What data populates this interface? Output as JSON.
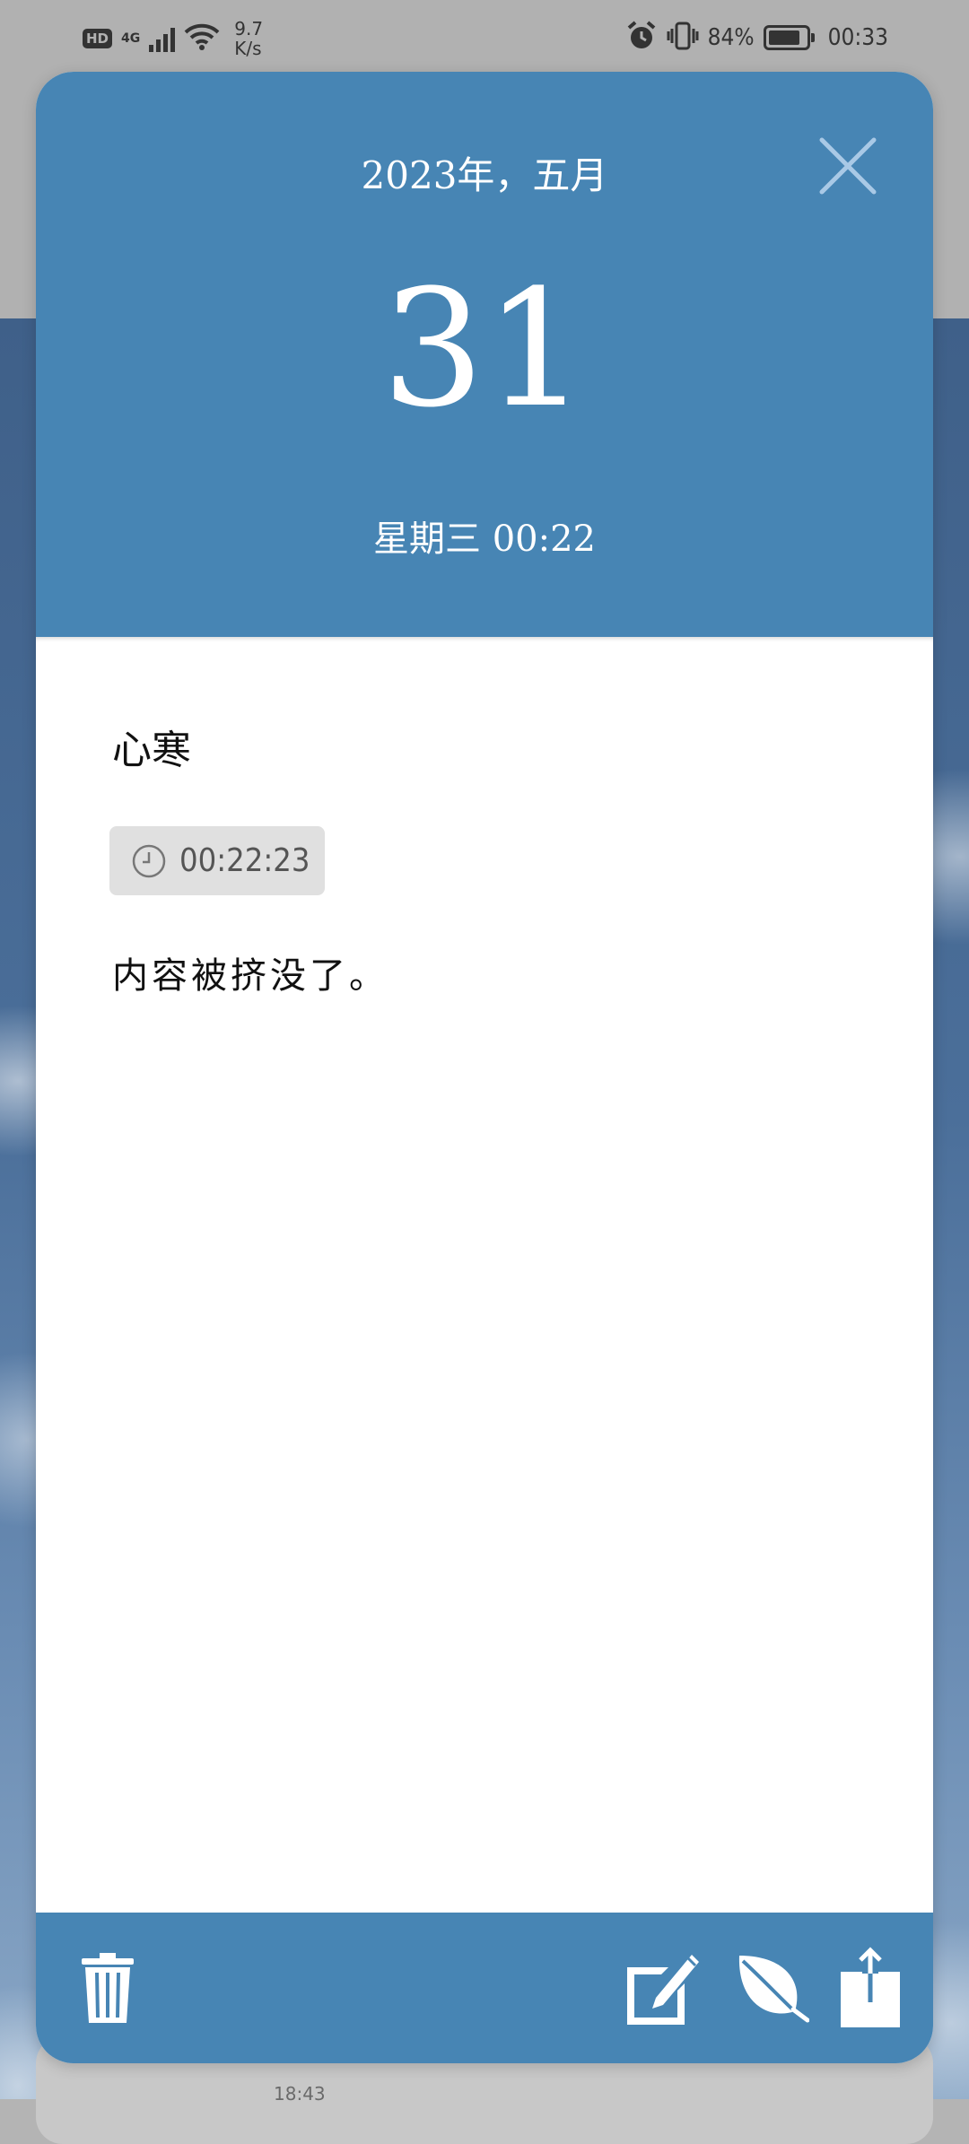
{
  "status_bar": {
    "hd_label": "HD",
    "network_label": "4G",
    "speed_value": "9.7",
    "speed_unit": "K/s",
    "battery_percent": "84%",
    "battery_level": 0.84,
    "time": "00:33"
  },
  "header": {
    "year_month": "2023年，五月",
    "day": "31",
    "weekday_time": "星期三 00:22"
  },
  "note": {
    "title": "心寒",
    "timestamp": "00:22:23",
    "content": "内容被挤没了。"
  },
  "background_card": {
    "text": "18:43"
  },
  "colors": {
    "accent": "#4785b4",
    "chip_bg": "#e0e0e0"
  },
  "icons": {
    "close": "close-icon",
    "delete": "trash-icon",
    "edit": "edit-icon",
    "leaf": "leaf-icon",
    "share": "share-icon",
    "clock": "clock-icon"
  }
}
